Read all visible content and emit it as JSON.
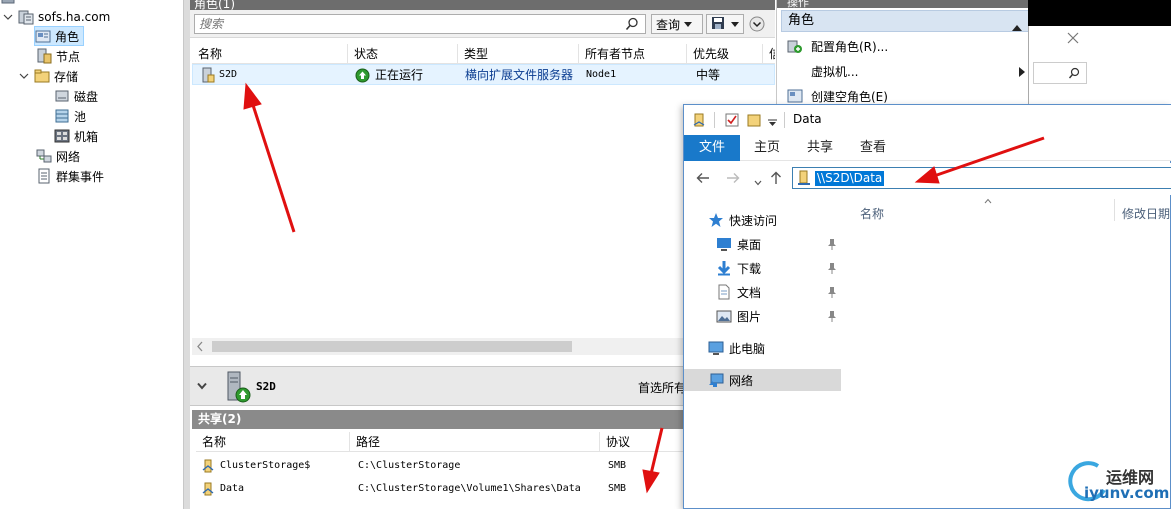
{
  "tree": {
    "root_label": "sofs.ha.com",
    "items": [
      {
        "label": "角色"
      },
      {
        "label": "节点"
      },
      {
        "label": "存储"
      },
      {
        "label": "磁盘"
      },
      {
        "label": "池"
      },
      {
        "label": "机箱"
      },
      {
        "label": "网络"
      },
      {
        "label": "群集事件"
      }
    ]
  },
  "middle": {
    "title": "角色(1)",
    "search_placeholder": "搜索",
    "query_label": "查询",
    "columns": [
      "名称",
      "状态",
      "类型",
      "所有者节点",
      "优先级",
      "信"
    ],
    "rows": [
      {
        "name": "S2D",
        "status": "正在运行",
        "type": "横向扩展文件服务器",
        "owner": "Node1",
        "priority": "中等"
      }
    ],
    "detail": {
      "name": "S2D",
      "preferred_owner": "首选所有者"
    },
    "shares": {
      "header": "共享(2)",
      "columns": [
        "名称",
        "路径",
        "协议"
      ],
      "rows": [
        {
          "name": "ClusterStorage$",
          "path": "C:\\ClusterStorage",
          "protocol": "SMB"
        },
        {
          "name": "Data",
          "path": "C:\\ClusterStorage\\Volume1\\Shares\\Data",
          "protocol": "SMB"
        }
      ]
    }
  },
  "actions": {
    "title": "操作",
    "group": "角色",
    "items": [
      {
        "label": "配置角色(R)..."
      },
      {
        "label": "虚拟机..."
      },
      {
        "label": "创建空角色(E)"
      }
    ]
  },
  "explorer": {
    "title": "Data",
    "tabs": [
      "文件",
      "主页",
      "共享",
      "查看"
    ],
    "address": "\\\\S2D\\Data",
    "nav": [
      {
        "label": "快速访问"
      },
      {
        "label": "桌面"
      },
      {
        "label": "下载"
      },
      {
        "label": "文档"
      },
      {
        "label": "图片"
      },
      {
        "label": "此电脑"
      },
      {
        "label": "网络"
      }
    ],
    "col_name": "名称",
    "col_modified": "修改日期"
  },
  "watermark": {
    "cn": "运维网",
    "url": "iyunv.com"
  },
  "colors": {
    "accent": "#1979ca",
    "selection": "#cce8ff",
    "arrow": "#e01010",
    "running": "#2e9a2e"
  }
}
